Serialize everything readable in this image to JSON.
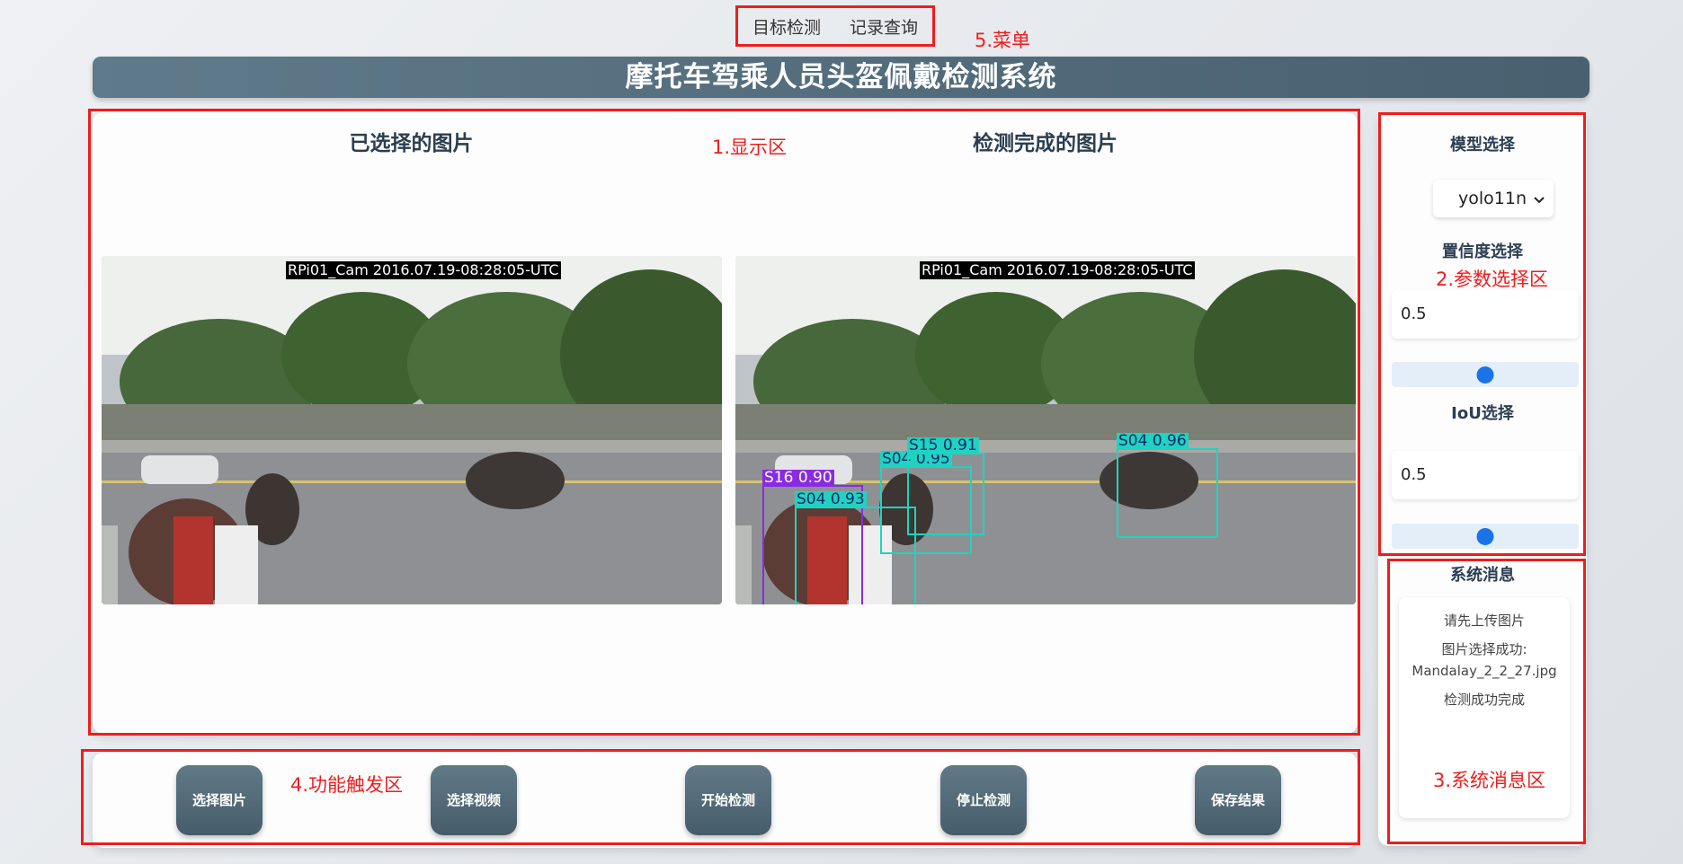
{
  "menu": {
    "items": [
      {
        "label": "目标检测"
      },
      {
        "label": "记录查询"
      }
    ]
  },
  "annotations": {
    "menu": "5.菜单",
    "display": "1.显示区",
    "params": "2.参数选择区",
    "messages": "3.系统消息区",
    "buttons": "4.功能触发区"
  },
  "header": {
    "title": "摩托车驾乘人员头盔佩戴检测系统"
  },
  "display": {
    "selected_title": "已选择的图片",
    "detected_title": "检测完成的图片",
    "camera_caption": "RPi01_Cam  2016.07.19-08:28:05-UTC",
    "detections": [
      {
        "label": "S16  0.90",
        "color": "#8a2be2"
      },
      {
        "label": "S04  0.93",
        "color": "#1fd3c0"
      },
      {
        "label": "S04  0.95",
        "color": "#1fd3c0"
      },
      {
        "label": "S15  0.91",
        "color": "#1fd3c0"
      },
      {
        "label": "S04  0.96",
        "color": "#1fd3c0"
      }
    ]
  },
  "params": {
    "model_heading": "模型选择",
    "model_value": "yolo11n",
    "conf_heading": "置信度选择",
    "conf_value": "0.5",
    "conf_slider_fraction": 0.5,
    "iou_heading": "IoU选择",
    "iou_value": "0.5",
    "iou_slider_fraction": 0.5
  },
  "messages": {
    "heading": "系统消息",
    "items": [
      "请先上传图片",
      "图片选择成功: Mandalay_2_2_27.jpg",
      "检测成功完成"
    ]
  },
  "buttons": {
    "select_image": "选择图片",
    "select_video": "选择视频",
    "start_detect": "开始检测",
    "stop_detect": "停止检测",
    "save_result": "保存结果"
  },
  "colors": {
    "accent": "#1a73e8",
    "header_bg": "#566f7e",
    "annotation_red": "#ee1d1d"
  }
}
